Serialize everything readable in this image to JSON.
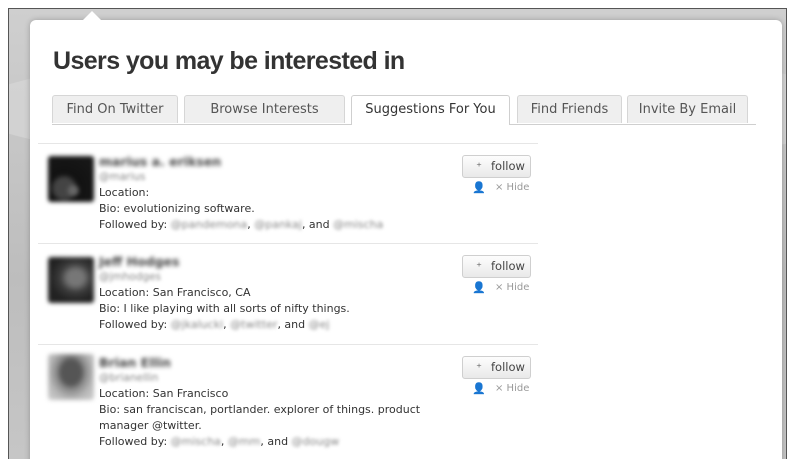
{
  "title": "Users you may be interested in",
  "tabs": [
    {
      "label": "Find On Twitter"
    },
    {
      "label": "Browse Interests"
    },
    {
      "label": "Suggestions For You"
    },
    {
      "label": "Find Friends"
    },
    {
      "label": "Invite By Email"
    }
  ],
  "follow_label": "follow",
  "hide_label": "× Hide",
  "users": [
    {
      "name": "marius a. eriksen",
      "handle": "@marius",
      "location": "Location:",
      "bio": "Bio: evolutionizing software.",
      "followed_prefix": "Followed by: ",
      "followed_1": "@pandemona",
      "sep1": ", ",
      "followed_2": "@pankaj",
      "sep2": ", and ",
      "followed_3": "@mischa"
    },
    {
      "name": "Jeff Hodges",
      "handle": "@jmhodges",
      "location": "Location: San Francisco, CA",
      "bio": "Bio: I like playing with all sorts of nifty things.",
      "followed_prefix": "Followed by: ",
      "followed_1": "@jkalucki",
      "sep1": ", ",
      "followed_2": "@twitter",
      "sep2": ", and ",
      "followed_3": "@ej"
    },
    {
      "name": "Brian Ellin",
      "handle": "@brianellin",
      "location": "Location: San Francisco",
      "bio": "Bio: san franciscan, portlander. explorer of things. product",
      "bio2": "manager @twitter.",
      "followed_prefix": "Followed by: ",
      "followed_1": "@mischa",
      "sep1": ", ",
      "followed_2": "@mm",
      "sep2": ", and ",
      "followed_3": "@dougw"
    }
  ]
}
